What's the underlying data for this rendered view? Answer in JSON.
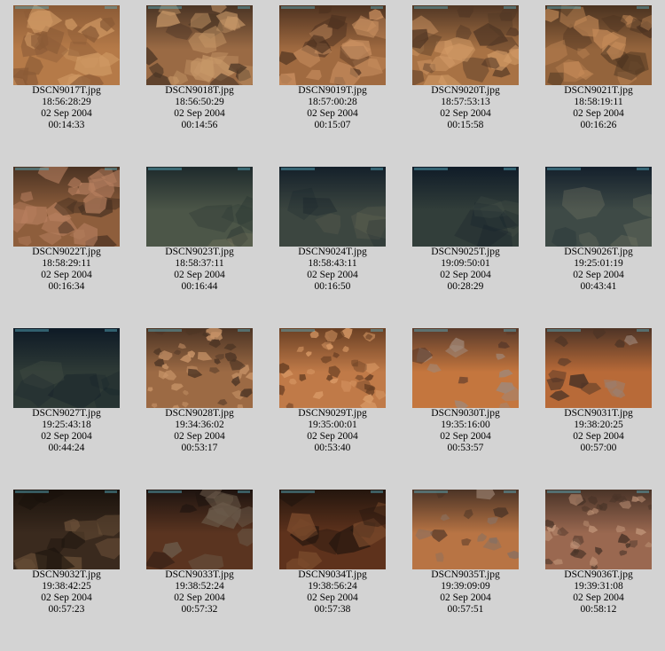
{
  "thumbnails": [
    {
      "filename": "DSCN9017T.jpg",
      "time": "18:56:28:29",
      "date": "02 Sep 2004",
      "elapsed": "00:14:33",
      "palette": [
        "#b57a48",
        "#8a5a36",
        "#d09a64"
      ],
      "style": "rocky"
    },
    {
      "filename": "DSCN9018T.jpg",
      "time": "18:56:50:29",
      "date": "02 Sep 2004",
      "elapsed": "00:14:56",
      "palette": [
        "#9a6a44",
        "#4a3424",
        "#c89868"
      ],
      "style": "rocky"
    },
    {
      "filename": "DSCN9019T.jpg",
      "time": "18:57:00:28",
      "date": "02 Sep 2004",
      "elapsed": "00:15:07",
      "palette": [
        "#a06a40",
        "#4e3220",
        "#cc9262"
      ],
      "style": "rocky"
    },
    {
      "filename": "DSCN9020T.jpg",
      "time": "18:57:53:13",
      "date": "02 Sep 2004",
      "elapsed": "00:15:58",
      "palette": [
        "#a87244",
        "#503624",
        "#d49c68"
      ],
      "style": "rocky"
    },
    {
      "filename": "DSCN9021T.jpg",
      "time": "18:58:19:11",
      "date": "02 Sep 2004",
      "elapsed": "00:16:26",
      "palette": [
        "#94643c",
        "#4a3220",
        "#c48a58"
      ],
      "style": "rocky"
    },
    {
      "filename": "DSCN9022T.jpg",
      "time": "18:58:29:11",
      "date": "02 Sep 2004",
      "elapsed": "00:16:34",
      "palette": [
        "#8e5e3c",
        "#4a3222",
        "#b88060"
      ],
      "style": "rocky"
    },
    {
      "filename": "DSCN9023T.jpg",
      "time": "18:58:37:11",
      "date": "02 Sep 2004",
      "elapsed": "00:16:44",
      "palette": [
        "#4c5648",
        "#1e2a2c",
        "#8c8468"
      ],
      "style": "dark"
    },
    {
      "filename": "DSCN9024T.jpg",
      "time": "18:58:43:11",
      "date": "02 Sep 2004",
      "elapsed": "00:16:50",
      "palette": [
        "#3c4640",
        "#14202a",
        "#6c6c58"
      ],
      "style": "dark"
    },
    {
      "filename": "DSCN9025T.jpg",
      "time": "19:09:50:01",
      "date": "02 Sep 2004",
      "elapsed": "00:28:29",
      "palette": [
        "#323e3a",
        "#101c28",
        "#505a4e"
      ],
      "style": "dark"
    },
    {
      "filename": "DSCN9026T.jpg",
      "time": "19:25:01:19",
      "date": "02 Sep 2004",
      "elapsed": "00:43:41",
      "palette": [
        "#3e4a46",
        "#14202c",
        "#7a7c68"
      ],
      "style": "dark"
    },
    {
      "filename": "DSCN9027T.jpg",
      "time": "19:25:43:18",
      "date": "02 Sep 2004",
      "elapsed": "00:44:24",
      "palette": [
        "#2e3a36",
        "#0e1a26",
        "#4c5648"
      ],
      "style": "dark"
    },
    {
      "filename": "DSCN9028T.jpg",
      "time": "19:34:36:02",
      "date": "02 Sep 2004",
      "elapsed": "00:53:17",
      "palette": [
        "#9c6a44",
        "#4c3424",
        "#c89468"
      ],
      "style": "rubble"
    },
    {
      "filename": "DSCN9029T.jpg",
      "time": "19:35:00:01",
      "date": "02 Sep 2004",
      "elapsed": "00:53:40",
      "palette": [
        "#c07a48",
        "#6a4024",
        "#d89a66"
      ],
      "style": "rubble"
    },
    {
      "filename": "DSCN9030T.jpg",
      "time": "19:35:16:00",
      "date": "02 Sep 2004",
      "elapsed": "00:53:57",
      "palette": [
        "#c4763e",
        "#5a3a2a",
        "#a08878"
      ],
      "style": "boulders"
    },
    {
      "filename": "DSCN9031T.jpg",
      "time": "19:38:20:25",
      "date": "02 Sep 2004",
      "elapsed": "00:57:00",
      "palette": [
        "#b86a38",
        "#4e3426",
        "#9a8070"
      ],
      "style": "boulders"
    },
    {
      "filename": "DSCN9032T.jpg",
      "time": "19:38:42:25",
      "date": "02 Sep 2004",
      "elapsed": "00:57:23",
      "palette": [
        "#3a2a1e",
        "#1a120c",
        "#6a5038"
      ],
      "style": "darkrock"
    },
    {
      "filename": "DSCN9033T.jpg",
      "time": "19:38:52:24",
      "date": "02 Sep 2004",
      "elapsed": "00:57:32",
      "palette": [
        "#5a3420",
        "#1e1410",
        "#6a5a4a"
      ],
      "style": "darkrock"
    },
    {
      "filename": "DSCN9034T.jpg",
      "time": "19:38:56:24",
      "date": "02 Sep 2004",
      "elapsed": "00:57:38",
      "palette": [
        "#5e321c",
        "#24160e",
        "#7a4a2c"
      ],
      "style": "darkrock"
    },
    {
      "filename": "DSCN9035T.jpg",
      "time": "19:39:09:09",
      "date": "02 Sep 2004",
      "elapsed": "00:57:51",
      "palette": [
        "#b87444",
        "#4c3426",
        "#8a7060"
      ],
      "style": "boulders"
    },
    {
      "filename": "DSCN9036T.jpg",
      "time": "19:39:31:08",
      "date": "02 Sep 2004",
      "elapsed": "00:58:12",
      "palette": [
        "#9a6850",
        "#4a3428",
        "#c09478"
      ],
      "style": "rubble"
    }
  ]
}
